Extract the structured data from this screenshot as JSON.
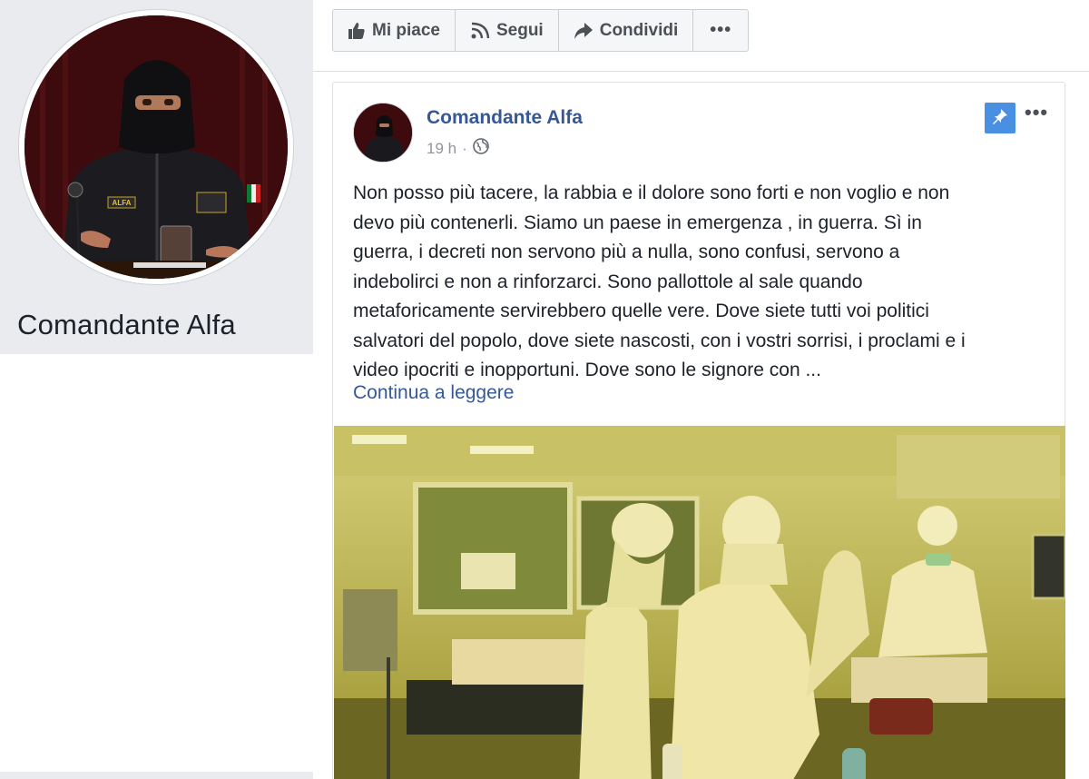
{
  "profile": {
    "name": "Comandante Alfa",
    "badge_text": "ALFA"
  },
  "action_bar": {
    "like_label": "Mi piace",
    "follow_label": "Segui",
    "share_label": "Condividi",
    "more_label": "•••"
  },
  "post": {
    "author": "Comandante Alfa",
    "time": "19 h",
    "separator": "·",
    "more_label": "•••",
    "text_lines": [
      "Non posso più tacere, la rabbia e il dolore sono forti e non voglio e non",
      "devo più contenerli. Siamo un paese in emergenza , in guerra. Sì in",
      "guerra, i decreti non servono più a nulla, sono confusi, servono a",
      "indebolirci e non a rinforzarci. Sono pallottole al sale quando",
      "metaforicamente servirebbero quelle vere. Dove siete tutti voi politici",
      "salvatori del popolo, dove siete nascosti, con i vostri sorrisi, i proclami e i",
      "video ipocriti e inopportuni. Dove sono le signore con ..."
    ],
    "read_more": "Continua a leggere"
  },
  "icons": {
    "like": "thumbs-up-icon",
    "follow": "rss-icon",
    "share": "share-arrow-icon",
    "privacy": "globe-icon",
    "pin": "pin-icon"
  },
  "colors": {
    "link": "#365899",
    "pin_bg": "#4a90e2",
    "sidebar_bg": "#e9ebee"
  }
}
